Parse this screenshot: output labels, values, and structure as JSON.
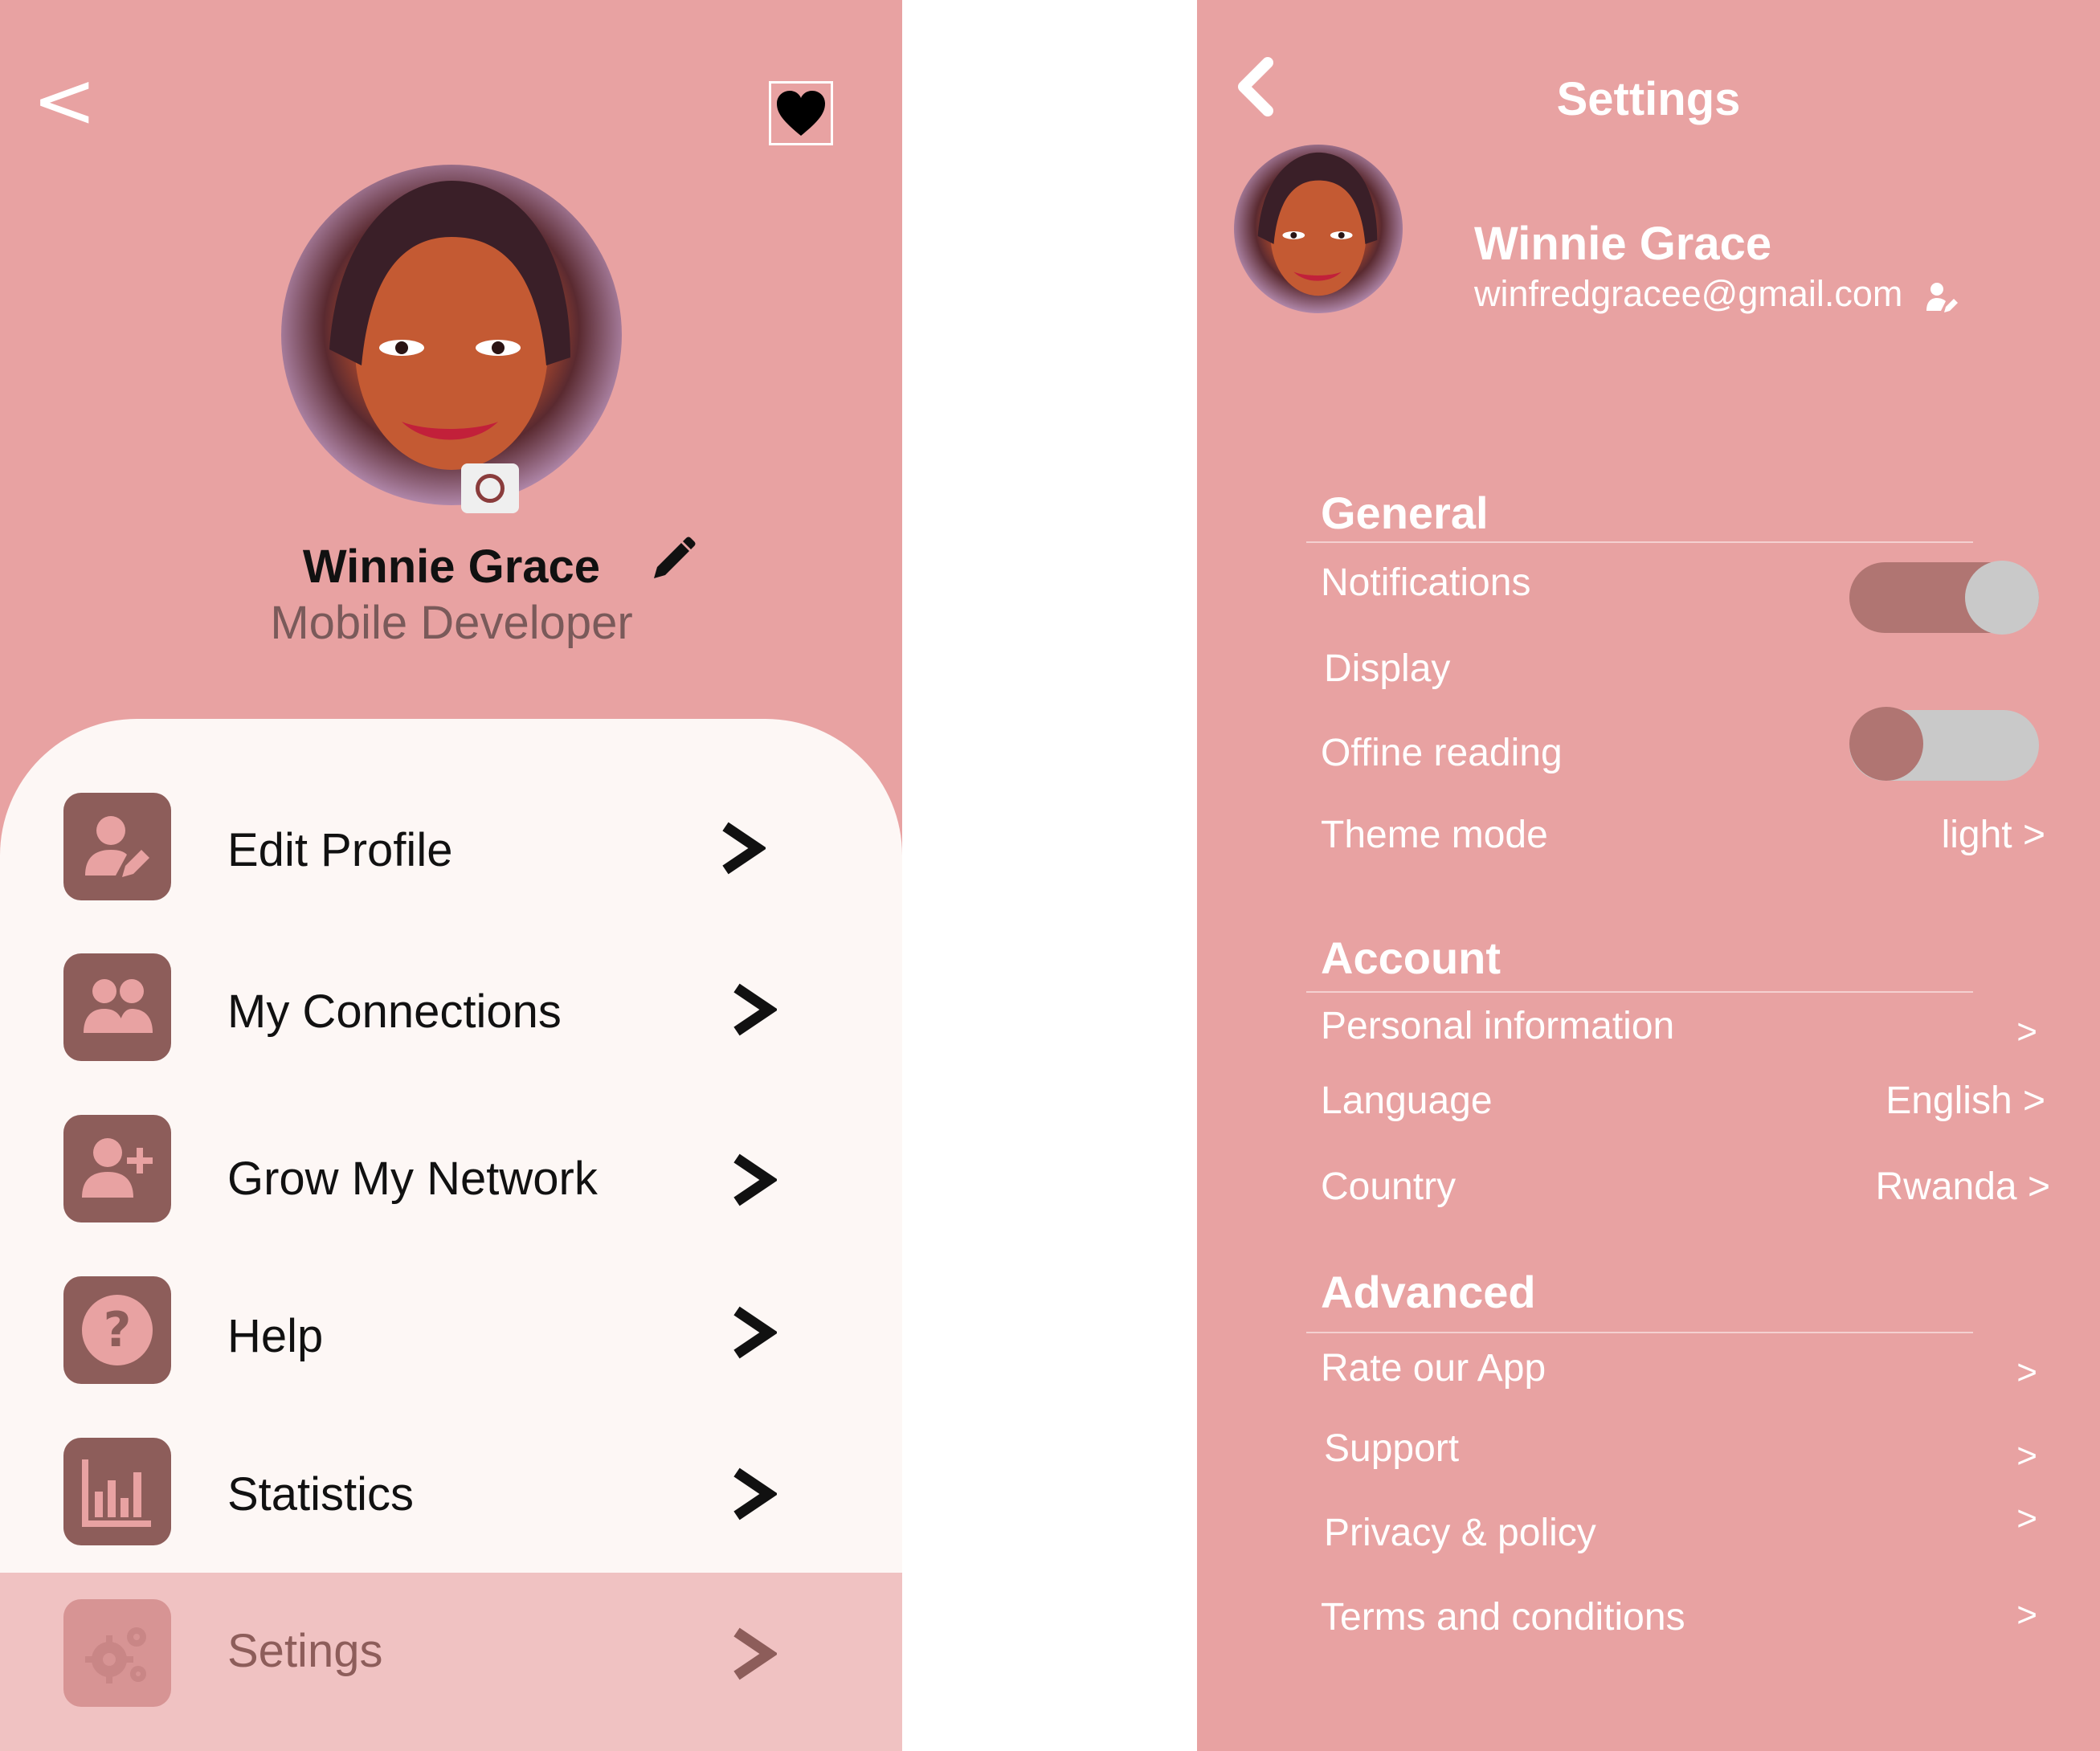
{
  "colors": {
    "panel_bg": "#e8a2a2",
    "card_bg": "#fdf7f5",
    "icon_tile": "#8d5d5a",
    "icon_glyph": "#e8a2a2",
    "settings_row_bg": "#f0c2c2",
    "toggle_track_on": "#b07572",
    "toggle_track_off": "#c9c9c9",
    "toggle_knob_on": "#c9c9c9",
    "toggle_knob_off": "#b07572"
  },
  "profile": {
    "back_label": "<",
    "favorite_icon": "heart-icon",
    "name": "Winnie Grace",
    "role": "Mobile Developer",
    "menu": [
      {
        "label": "Edit Profile",
        "icon": "user-edit-icon"
      },
      {
        "label": "My Connections",
        "icon": "users-icon"
      },
      {
        "label": "Grow My Network",
        "icon": "user-plus-icon"
      },
      {
        "label": "Help",
        "icon": "question-circle-icon"
      },
      {
        "label": "Statistics",
        "icon": "bar-chart-icon"
      },
      {
        "label": "Setings",
        "icon": "gears-icon"
      }
    ]
  },
  "settings": {
    "title": "Settings",
    "user": {
      "name": "Winnie Grace",
      "email": "winfredgracee@gmail.com"
    },
    "general": {
      "title": "General",
      "notifications": {
        "label": "Notifications",
        "enabled": true
      },
      "display": {
        "label": "Display"
      },
      "offline_reading": {
        "label": "Offine reading",
        "enabled": false
      },
      "theme_mode": {
        "label": "Theme mode",
        "value": "light >"
      }
    },
    "account": {
      "title": "Account",
      "personal_information": {
        "label": "Personal information",
        "arrow": ">"
      },
      "language": {
        "label": "Language",
        "value": "English >"
      },
      "country": {
        "label": "Country",
        "value": "Rwanda >"
      }
    },
    "advanced": {
      "title": "Advanced",
      "rate_app": {
        "label": "Rate our App",
        "arrow": ">"
      },
      "support": {
        "label": "Support",
        "arrow": ">"
      },
      "privacy": {
        "label": "Privacy & policy",
        "arrow": ">"
      },
      "terms": {
        "label": "Terms and conditions",
        "arrow": ">"
      }
    }
  }
}
